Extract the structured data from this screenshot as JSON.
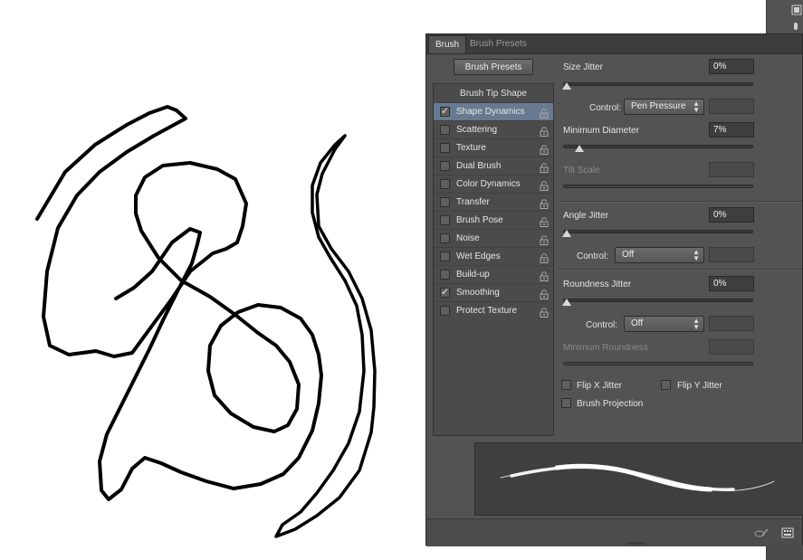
{
  "tabs": [
    {
      "label": "Brush",
      "active": true
    },
    {
      "label": "Brush Presets",
      "active": false
    }
  ],
  "brush_presets_button": "Brush Presets",
  "sidebar": {
    "header": "Brush Tip Shape",
    "items": [
      {
        "label": "Shape Dynamics",
        "checked": true,
        "selected": true
      },
      {
        "label": "Scattering",
        "checked": false
      },
      {
        "label": "Texture",
        "checked": false
      },
      {
        "label": "Dual Brush",
        "checked": false
      },
      {
        "label": "Color Dynamics",
        "checked": false
      },
      {
        "label": "Transfer",
        "checked": false
      },
      {
        "label": "Brush Pose",
        "checked": false
      },
      {
        "label": "Noise",
        "checked": false
      },
      {
        "label": "Wet Edges",
        "checked": false
      },
      {
        "label": "Build-up",
        "checked": false
      },
      {
        "label": "Smoothing",
        "checked": true
      },
      {
        "label": "Protect Texture",
        "checked": false
      }
    ]
  },
  "settings": {
    "size_jitter": {
      "label": "Size Jitter",
      "value": "0%",
      "level": 0.0
    },
    "size_control": {
      "label": "Control:",
      "value": "Pen Pressure"
    },
    "minimum_diameter": {
      "label": "Minimum Diameter",
      "value": "7%",
      "level": 0.07
    },
    "tilt_scale": {
      "label": "Tilt Scale",
      "disabled": true
    },
    "angle_jitter": {
      "label": "Angle Jitter",
      "value": "0%",
      "level": 0.0
    },
    "angle_control": {
      "label": "Control:",
      "value": "Off"
    },
    "roundness_jitter": {
      "label": "Roundness Jitter",
      "value": "0%",
      "level": 0.0
    },
    "roundness_control": {
      "label": "Control:",
      "value": "Off"
    },
    "minimum_roundness": {
      "label": "Minimum Roundness",
      "disabled": true
    },
    "flip_x": {
      "label": "Flip X Jitter",
      "checked": false
    },
    "flip_y": {
      "label": "Flip Y Jitter",
      "checked": false
    },
    "brush_projection": {
      "label": "Brush Projection",
      "checked": false
    }
  },
  "icons": {
    "checkmark": "check-icon",
    "lock": "lock-icon",
    "dropdown": "updown-arrow-icon",
    "footer_left": "brush-toggle-icon",
    "footer_right": "grid-icon"
  },
  "colors": {
    "panel_bg": "#535353",
    "selection": "#677a91",
    "stroke": "#000000"
  }
}
